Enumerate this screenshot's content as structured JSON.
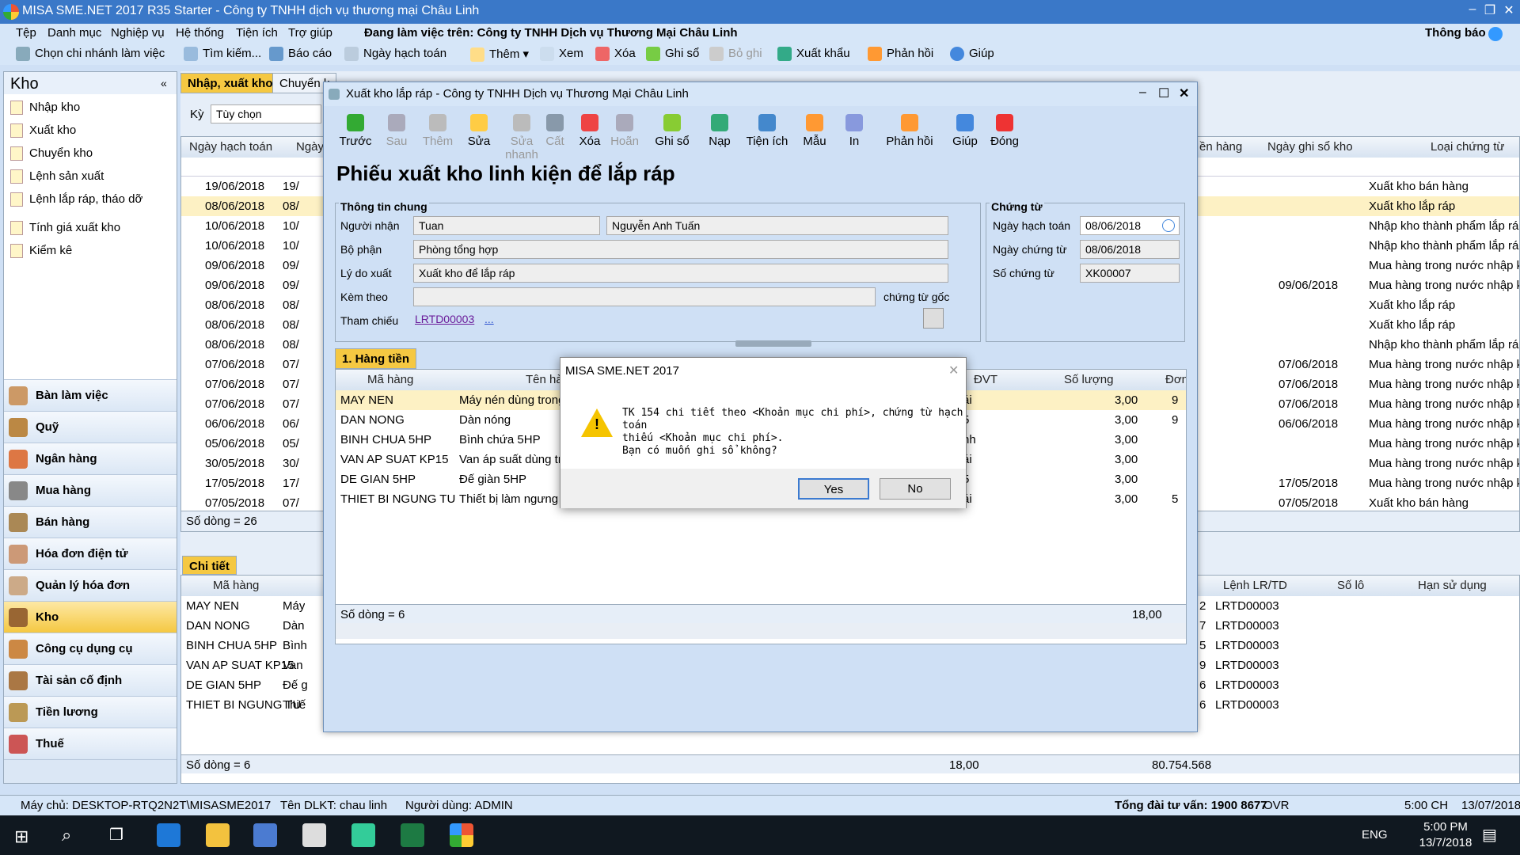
{
  "app": {
    "title": "MISA SME.NET 2017 R35 Starter - Công ty TNHH dịch vụ thương mại Châu Linh"
  },
  "menu": {
    "items": [
      "Tệp",
      "Danh mục",
      "Nghiệp vụ",
      "Hệ thống",
      "Tiện ích",
      "Trợ giúp"
    ],
    "working_label": "Đang làm việc trên: Công ty TNHH Dịch vụ Thương Mại Châu Linh",
    "notification": "Thông báo"
  },
  "toolbar": {
    "items": [
      "Chọn chi nhánh làm việc",
      "Tìm kiếm...",
      "Báo cáo",
      "Ngày hạch toán",
      "Thêm",
      "Xem",
      "Xóa",
      "Ghi sổ",
      "Bỏ ghi",
      "Xuất khẩu",
      "Phản hồi",
      "Giúp"
    ]
  },
  "left": {
    "title": "Kho",
    "links": [
      "Nhập kho",
      "Xuất kho",
      "Chuyển kho",
      "Lệnh sản xuất",
      "Lệnh lắp ráp, tháo dỡ",
      "Tính giá xuất kho",
      "Kiểm kê"
    ],
    "modules": [
      "Bàn làm việc",
      "Quỹ",
      "Ngân hàng",
      "Mua hàng",
      "Bán hàng",
      "Hóa đơn điện tử",
      "Quản lý hóa đơn",
      "Kho",
      "Công cụ dụng cụ",
      "Tài sản cố định",
      "Tiền lương",
      "Thuế"
    ]
  },
  "main": {
    "tabs": [
      "Nhập, xuất kho",
      "Chuyển k"
    ],
    "ky_label": "Kỳ",
    "ky_value": "Tùy chọn",
    "headers": {
      "c1": "Ngày hạch toán",
      "c2": "Ngày",
      "c3": "ền hàng",
      "c4": "Ngày ghi sổ kho",
      "c5": "Loại chứng từ"
    },
    "rows": [
      [
        "19/06/2018",
        "19/",
        "",
        "Xuất kho bán hàng"
      ],
      [
        "08/06/2018",
        "08/",
        "",
        "Xuất kho lắp ráp"
      ],
      [
        "10/06/2018",
        "10/",
        "",
        "Nhập kho thành phẩm lắp ráp"
      ],
      [
        "10/06/2018",
        "10/",
        "",
        "Nhập kho thành phẩm lắp ráp"
      ],
      [
        "09/06/2018",
        "09/",
        "",
        "Mua hàng trong nước nhập kho"
      ],
      [
        "09/06/2018",
        "09/",
        "09/06/2018",
        "Mua hàng trong nước nhập kho"
      ],
      [
        "08/06/2018",
        "08/",
        "",
        "Xuất kho lắp ráp"
      ],
      [
        "08/06/2018",
        "08/",
        "",
        "Xuất kho lắp ráp"
      ],
      [
        "08/06/2018",
        "08/",
        "",
        "Nhập kho thành phẩm lắp ráp"
      ],
      [
        "07/06/2018",
        "07/",
        "07/06/2018",
        "Mua hàng trong nước nhập kho"
      ],
      [
        "07/06/2018",
        "07/",
        "07/06/2018",
        "Mua hàng trong nước nhập kho"
      ],
      [
        "07/06/2018",
        "07/",
        "07/06/2018",
        "Mua hàng trong nước nhập kho"
      ],
      [
        "06/06/2018",
        "06/",
        "06/06/2018",
        "Mua hàng trong nước nhập kho"
      ],
      [
        "05/06/2018",
        "05/",
        "",
        "Mua hàng trong nước nhập kho"
      ],
      [
        "30/05/2018",
        "30/",
        "",
        "Mua hàng trong nước nhập kho"
      ],
      [
        "17/05/2018",
        "17/",
        "17/05/2018",
        "Mua hàng trong nước nhập kho"
      ],
      [
        "07/05/2018",
        "07/",
        "07/05/2018",
        "Xuất kho bán hàng"
      ]
    ],
    "row_count": "Số dòng = 26",
    "detail_tab": "Chi tiết",
    "detail_headers": {
      "c1": "Mã hàng",
      "c2": "Lệnh LR/TD",
      "c3": "Số lô",
      "c4": "Hạn sử dụng"
    },
    "detail_rows": [
      [
        "MAY NEN",
        "Máy",
        "2",
        "LRTD00003"
      ],
      [
        "DAN NONG",
        "Dàn",
        "7",
        "LRTD00003"
      ],
      [
        "BINH CHUA 5HP",
        "Bình",
        "5",
        "LRTD00003"
      ],
      [
        "VAN AP SUAT KP15",
        "Van",
        "9",
        "LRTD00003"
      ],
      [
        "DE GIAN 5HP",
        "Đế g",
        "6",
        "LRTD00003"
      ],
      [
        "THIET BI NGUNG TU",
        "Thiế",
        "6",
        "LRTD00003"
      ]
    ],
    "detail_count": "Số dòng = 6",
    "detail_total_qty": "18,00",
    "detail_total_amount": "80.754.568"
  },
  "dialog": {
    "title": "Xuất kho lắp ráp - Công ty TNHH Dịch vụ Thương Mại Châu Linh",
    "toolbar": [
      "Trước",
      "Sau",
      "Thêm",
      "Sửa",
      "Sửa nhanh",
      "Cất",
      "Xóa",
      "Hoãn",
      "Ghi sổ",
      "Nạp",
      "Tiện ích",
      "Mẫu",
      "In",
      "Phản hồi",
      "Giúp",
      "Đóng"
    ],
    "heading": "Phiếu xuất kho linh kiện để lắp ráp",
    "general": {
      "title": "Thông tin chung",
      "nguoi_nhan_label": "Người nhận",
      "nguoi_nhan_code": "Tuan",
      "nguoi_nhan_name": "Nguyễn Anh Tuấn",
      "bo_phan_label": "Bộ phận",
      "bo_phan": "Phòng tổng hợp",
      "ly_do_label": "Lý do xuất",
      "ly_do": "Xuất kho để lắp ráp",
      "kem_theo_label": "Kèm theo",
      "chung_tu_goc": "chứng từ gốc",
      "tham_chieu_label": "Tham chiếu",
      "tham_chieu": "LRTD00003",
      "tham_chieu_more": "..."
    },
    "voucher": {
      "title": "Chứng từ",
      "ngay_hach_toan_label": "Ngày hạch toán",
      "ngay_hach_toan": "08/06/2018",
      "ngay_chung_tu_label": "Ngày chứng từ",
      "ngay_chung_tu": "08/06/2018",
      "so_chung_tu_label": "Số chứng từ",
      "so_chung_tu": "XK00007"
    },
    "grid_tab": "1. Hàng tiền",
    "grid_headers": {
      "ma": "Mã hàng",
      "ten": "Tên hà",
      "dvt": "ĐVT",
      "sl": "Số lượng",
      "don": "Đơn"
    },
    "grid_rows": [
      [
        "MAY NEN",
        "Máy nén dùng trong t",
        "ái",
        "3,00",
        "9"
      ],
      [
        "DAN NONG",
        "Dàn nóng",
        "5",
        "3,00",
        "9"
      ],
      [
        "BINH CHUA 5HP",
        "Bình chứa 5HP",
        "nh",
        "3,00",
        ""
      ],
      [
        "VAN AP SUAT KP15",
        "Van áp suất dùng tro",
        "ái",
        "3,00",
        ""
      ],
      [
        "DE GIAN 5HP",
        "Đế giàn 5HP",
        "5",
        "3,00",
        ""
      ],
      [
        "THIET BI NGUNG TU",
        "Thiết bị làm ngưng tụ",
        "ái",
        "3,00",
        "5"
      ]
    ],
    "grid_count": "Số dòng = 6",
    "grid_total": "18,00"
  },
  "msgbox": {
    "title": "MISA SME.NET 2017",
    "line1": "TK 154 chi tiết theo <Khoản mục chi phí>, chứng từ hạch toán",
    "line2": "thiếu <Khoản mục chi phí>.",
    "line3": "Bạn có muốn ghi sổ không?",
    "yes": "Yes",
    "no": "No"
  },
  "status": {
    "server": "Máy chủ: DESKTOP-RTQ2N2T\\MISASME2017",
    "dlkt": "Tên DLKT: chau linh",
    "user": "Người dùng: ADMIN",
    "hotline": "Tổng đài tư vấn: 1900 8677",
    "ovr": "OVR",
    "time": "5:00 CH",
    "date": "13/07/2018"
  },
  "taskbar": {
    "lang": "ENG",
    "time": "5:00 PM",
    "date": "13/7/2018"
  }
}
